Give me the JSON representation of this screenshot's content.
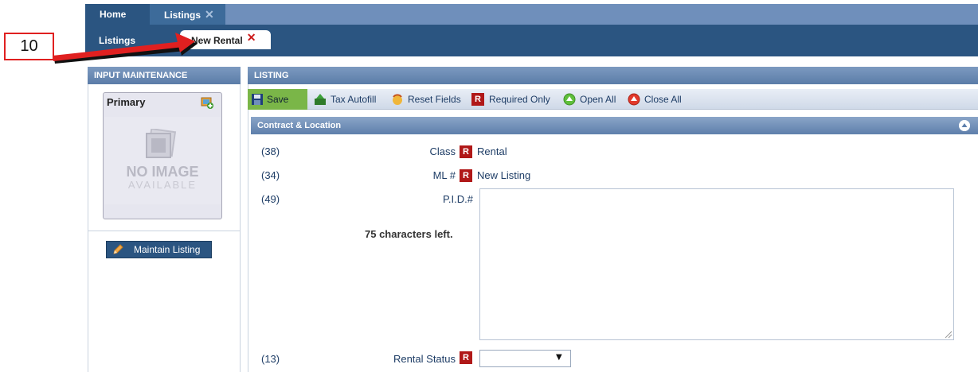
{
  "top_tabs": [
    {
      "label": "Home"
    },
    {
      "label": "Listings",
      "close": "✕"
    }
  ],
  "sub_tabs": [
    {
      "label": "Listings"
    },
    {
      "label": "New Rental",
      "close": "✕"
    }
  ],
  "annotation": {
    "number": "10"
  },
  "left_panel": {
    "header": "INPUT MAINTENANCE",
    "photo_card": {
      "title": "Primary",
      "no_image": "NO IMAGE",
      "available": "AVAILABLE"
    },
    "maintain_button": "Maintain Listing"
  },
  "right_panel": {
    "header": "LISTING",
    "toolbar": {
      "save": "Save",
      "tax_autofill": "Tax Autofill",
      "reset_fields": "Reset Fields",
      "required_only": "Required Only",
      "open_all": "Open All",
      "close_all": "Close All",
      "required_badge": "R"
    },
    "section": {
      "title": "Contract & Location",
      "fields": [
        {
          "num": "(38)",
          "label": "Class",
          "badge": "R",
          "value": "Rental"
        },
        {
          "num": "(34)",
          "label": "ML #",
          "badge": "R",
          "value": "New Listing"
        },
        {
          "num": "(49)",
          "label": "P.I.D.#",
          "value": "",
          "chars_left": "75 characters left."
        },
        {
          "num": "(13)",
          "label": "Rental Status",
          "badge": "R",
          "value": ""
        }
      ]
    }
  },
  "colors": {
    "nav_dark": "#2b5581",
    "nav_light": "#6f8fbb",
    "required_red": "#b01818",
    "save_green": "#7ab648",
    "annotation_red": "#e02020"
  }
}
